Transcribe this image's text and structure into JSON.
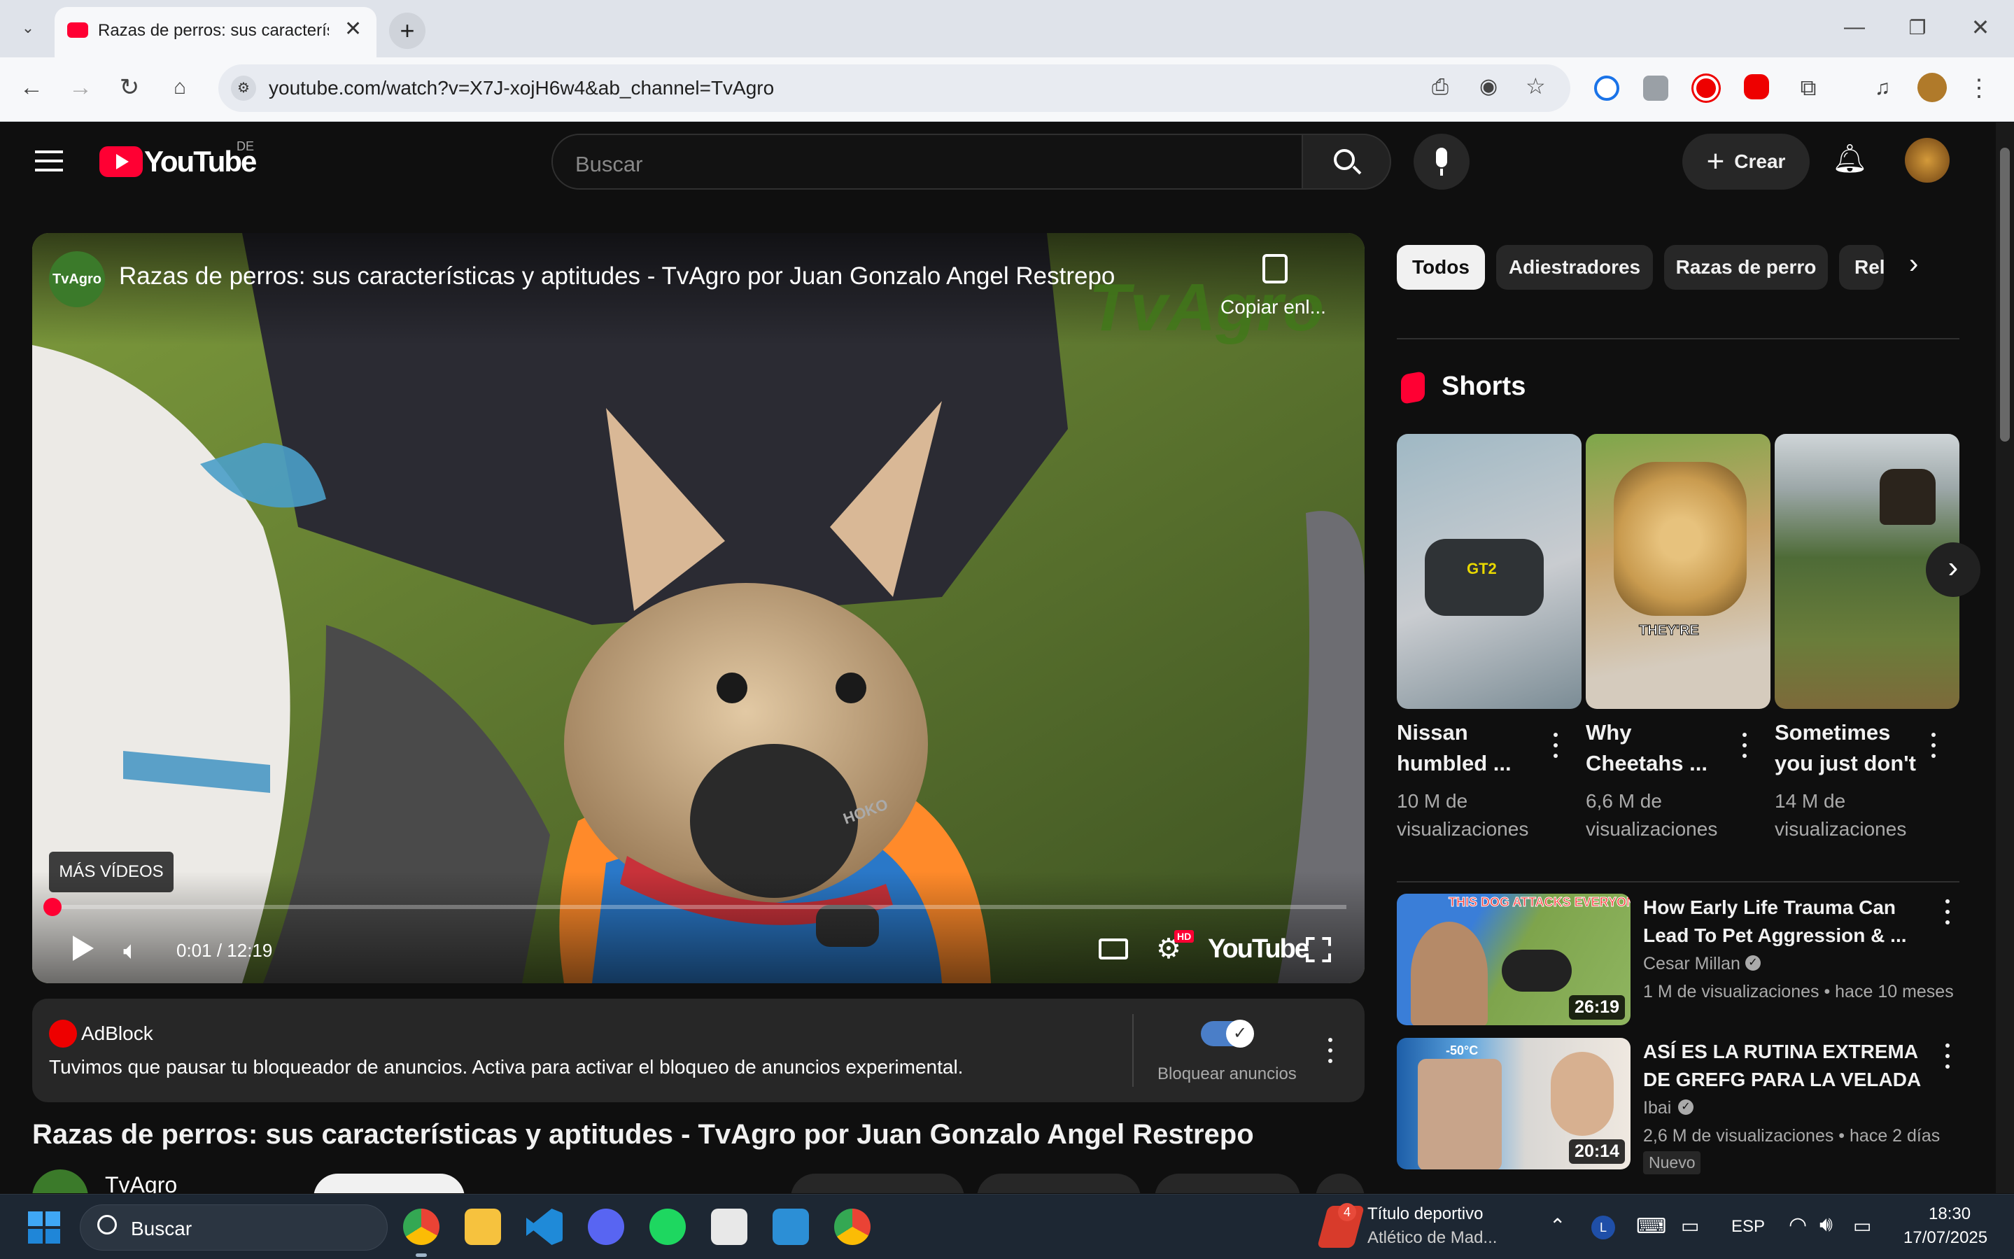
{
  "browser": {
    "tab_title": "Razas de perros: sus característ",
    "url": "youtube.com/watch?v=X7J-xojH6w4&ab_channel=TvAgro"
  },
  "youtube": {
    "logo_text": "YouTube",
    "region": "DE",
    "search_placeholder": "Buscar",
    "create_label": "Crear",
    "chips": [
      "Todos",
      "Adiestradores",
      "Razas de perro",
      "Rel"
    ],
    "shorts_heading": "Shorts",
    "shorts": [
      {
        "title": "Nissan humbled ...",
        "views": "10 M de visualizaciones",
        "overlay": "GT2"
      },
      {
        "title": "Why Cheetahs ...",
        "views": "6,6 M de visualizaciones",
        "overlay": "THEY'RE"
      },
      {
        "title": "Sometimes you just don't",
        "views": "14 M de visualizaciones",
        "overlay": ""
      }
    ],
    "recommended": [
      {
        "title": "How Early Life Trauma Can Lead To Pet Aggression & ...",
        "channel": "Cesar Millan",
        "meta": "1 M de visualizaciones • hace 10 meses",
        "duration": "26:19",
        "thumb_text": "THIS DOG ATTACKS EVERYONE!",
        "badge": ""
      },
      {
        "title": "ASÍ ES LA RUTINA EXTREMA DE GREFG PARA LA VELADA",
        "channel": "Ibai",
        "meta": "2,6 M de visualizaciones • hace 2 días",
        "duration": "20:14",
        "thumb_text": "-50°C",
        "badge": "Nuevo"
      }
    ]
  },
  "player": {
    "title": "Razas de perros: sus características y aptitudes - TvAgro por Juan Gonzalo Angel Restrepo",
    "channel_badge": "TvAgro",
    "watermark": "TvAgro",
    "copy_link": "Copiar enl...",
    "more_videos": "MÁS VÍDEOS",
    "time": "0:01 / 12:19",
    "progress": 0.001,
    "yt_brand": "YouTube",
    "hd_badge": "HD",
    "tag_text": "HOKO"
  },
  "adblock": {
    "brand": "AdBlock",
    "message": "Tuvimos que pausar tu bloqueador de anuncios. Activa para activar el bloqueo de anuncios experimental.",
    "toggle_label": "Bloquear anuncios",
    "toggle_on": true
  },
  "video": {
    "title": "Razas de perros: sus características y aptitudes - TvAgro por Juan Gonzalo Angel Restrepo",
    "channel": "TvAgro"
  },
  "taskbar": {
    "search_placeholder": "Buscar",
    "news_title": "Título deportivo",
    "news_sub": "Atlético de Mad...",
    "news_count": "4",
    "lang": "ESP",
    "time": "18:30",
    "date": "17/07/2025",
    "colors": {
      "accent": "#0078d4"
    }
  },
  "colors": {
    "yt_red": "#ff0033",
    "bg": "#0f0f0f",
    "chip": "#272727"
  }
}
